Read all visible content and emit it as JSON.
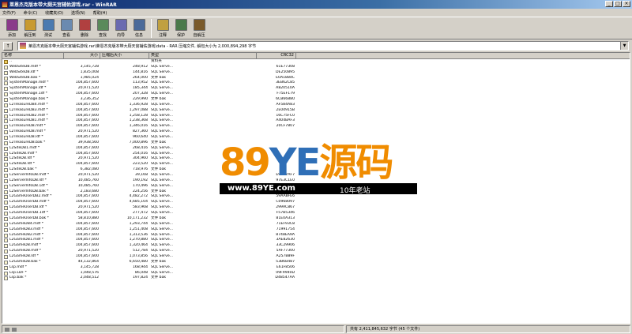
{
  "window": {
    "title": "莱恩杰克版本带大厕天宫辅佑游戏.rar - WinRAR",
    "min": "_",
    "max": "□",
    "close": "×"
  },
  "menu": [
    "文件(F)",
    "命令(C)",
    "收藏夹(O)",
    "选项(N)",
    "帮助(H)"
  ],
  "toolbar": [
    {
      "label": "添加",
      "icon": "add-icon",
      "color": "#8a3a8a"
    },
    {
      "label": "解压到",
      "icon": "extract-to-icon",
      "color": "#c89a30"
    },
    {
      "label": "测试",
      "icon": "test-icon",
      "color": "#4a7ab0"
    },
    {
      "label": "查看",
      "icon": "view-icon",
      "color": "#6a8ab0"
    },
    {
      "label": "删除",
      "icon": "delete-icon",
      "color": "#b04040"
    },
    {
      "label": "查找",
      "icon": "find-icon",
      "color": "#5a8a5a"
    },
    {
      "label": "向导",
      "icon": "wizard-icon",
      "color": "#6a6ab0"
    },
    {
      "label": "信息",
      "icon": "info-icon",
      "color": "#4a6a9a"
    },
    {
      "label": "注释",
      "icon": "comment-icon",
      "color": "#c0a040"
    },
    {
      "label": "保护",
      "icon": "protect-icon",
      "color": "#4a7a4a"
    },
    {
      "label": "自解压",
      "icon": "sfx-icon",
      "color": "#7a5a2a"
    }
  ],
  "path": {
    "text": "莱恩杰克版本带大厕天宫辅佑游戏.rar\\莱恩杰克版本带大厕天宫辅佑游戏\\data - RAR 压缩文件, 解包大小为 2,000,894,298 字节"
  },
  "columns": {
    "name": "名称",
    "size": "大小",
    "packed": "压缩后大小",
    "type": "类型",
    "crc": "CRC32"
  },
  "rows": [
    {
      "name": "..",
      "size": "",
      "packed": "",
      "type": "资料夹",
      "crc": "",
      "up": true
    },
    {
      "name": "WebSiteDB.mdf *",
      "size": "3,145,728",
      "packed": "248,912",
      "type": "SQL Serve...",
      "crc": "61E77308"
    },
    {
      "name": "WebSiteDB.ldf *",
      "size": "1,835,008",
      "packed": "144,816",
      "type": "SQL Serve...",
      "crc": "DE250895"
    },
    {
      "name": "WebSiteDB.bak *",
      "size": "1,985,024",
      "packed": "264,000",
      "type": "文件 bak",
      "crc": "E0A1884C"
    },
    {
      "name": "SystemManage.mdf *",
      "size": "104,857,600",
      "packed": "113,952",
      "type": "SQL Serve...",
      "crc": "3EB62C85"
    },
    {
      "name": "SystemManage.ldf *",
      "size": "20,971,520",
      "packed": "185,344",
      "type": "SQL Serve...",
      "crc": "A820510A"
    },
    {
      "name": "SystemManage.1df *",
      "size": "104,857,600",
      "packed": "207,328",
      "type": "SQL Serve...",
      "crc": "F75EF179"
    },
    {
      "name": "SystemManage.bak *",
      "size": "3,236,352",
      "packed": "229,990",
      "type": "文件 bak",
      "crc": "6CB66880"
    },
    {
      "name": "L2TreasureDB4.mdf *",
      "size": "104,857,600",
      "packed": "1,336,928",
      "type": "SQL Serve...",
      "crc": "AF584A83"
    },
    {
      "name": "L2TreasureDB3.mdf *",
      "size": "104,857,600",
      "packed": "1,297,088",
      "type": "SQL Serve...",
      "crc": "2E04915B"
    },
    {
      "name": "L2TreasureDB2.mdf *",
      "size": "104,857,600",
      "packed": "1,258,128",
      "type": "SQL Serve...",
      "crc": "16C75FC0"
    },
    {
      "name": "L2TreasureDB1.mdf *",
      "size": "104,857,600",
      "packed": "1,238,368",
      "type": "SQL Serve...",
      "crc": "A404BAF3"
    },
    {
      "name": "L2TreasureDB.mdf *",
      "size": "104,857,600",
      "packed": "1,346,016",
      "type": "SQL Serve...",
      "crc": "20CF7807"
    },
    {
      "name": "L2TreasureDB.mdf *",
      "size": "20,971,520",
      "packed": "827,360",
      "type": "SQL Serve...",
      "crc": ""
    },
    {
      "name": "L2TreasureDB.ldf *",
      "size": "104,857,600",
      "packed": "960,640",
      "type": "SQL Serve...",
      "crc": ""
    },
    {
      "name": "L2TreasureDB.bak *",
      "size": "39,938,560",
      "packed": "7,000,896",
      "type": "文件 bak",
      "crc": ""
    },
    {
      "name": "L2SiteDB1.mdf *",
      "size": "104,857,600",
      "packed": "268,416",
      "type": "SQL Serve...",
      "crc": ""
    },
    {
      "name": "L2SiteDB.mdf *",
      "size": "104,857,600",
      "packed": "254,016",
      "type": "SQL Serve...",
      "crc": ""
    },
    {
      "name": "L2SiteDB.ldf *",
      "size": "20,971,520",
      "packed": "304,960",
      "type": "SQL Serve...",
      "crc": ""
    },
    {
      "name": "L2SiteDB.ldf *",
      "size": "104,857,600",
      "packed": "223,520",
      "type": "SQL Serve...",
      "crc": ""
    },
    {
      "name": "L2SiteDB.bak *",
      "size": "6,382,080",
      "packed": "718,976",
      "type": "文件 bak",
      "crc": ""
    },
    {
      "name": "L2ServerInfoDB.mdf *",
      "size": "20,971,520",
      "packed": "39,168",
      "type": "SQL Serve...",
      "crc": "E93C7AF7"
    },
    {
      "name": "L2ServerInfoDB.ldf *",
      "size": "10,485,760",
      "packed": "190,192",
      "type": "SQL Serve...",
      "crc": "97E3C1E0"
    },
    {
      "name": "L2ServerInfoDB.1df *",
      "size": "10,485,760",
      "packed": "170,496",
      "type": "SQL Serve...",
      "crc": "7A13BC8F"
    },
    {
      "name": "L2ServerInfoDB.bak *",
      "size": "2,183,680",
      "packed": "224,256",
      "type": "文件 bak",
      "crc": "0C35994C"
    },
    {
      "name": "L2GameUserDB2.mdf *",
      "size": "104,857,600",
      "packed": "4,482,272",
      "type": "SQL Serve...",
      "crc": "59AA8FE6"
    },
    {
      "name": "L2GameUserDB.mdf *",
      "size": "104,857,600",
      "packed": "4,685,104",
      "type": "SQL Serve...",
      "crc": "C0968097"
    },
    {
      "name": "L2GameUserDB.ldf *",
      "size": "20,971,520",
      "packed": "583,968",
      "type": "SQL Serve...",
      "crc": "299AC867"
    },
    {
      "name": "L2GameUserDB.1df *",
      "size": "104,857,600",
      "packed": "277,472",
      "type": "SQL Serve...",
      "crc": "F57B5346"
    },
    {
      "name": "L2GameUserDB.bak *",
      "size": "58,810,880",
      "packed": "10,171,232",
      "type": "文件 bak",
      "crc": "81E0A313"
    },
    {
      "name": "L2GameDB4.mdf *",
      "size": "104,857,600",
      "packed": "1,293,744",
      "type": "SQL Serve...",
      "crc": "71EF93C8"
    },
    {
      "name": "L2GameDB3.mdf *",
      "size": "104,857,600",
      "packed": "1,251,408",
      "type": "SQL Serve...",
      "crc": "71991754"
    },
    {
      "name": "L2GameDB2.mdf *",
      "size": "104,857,600",
      "packed": "1,313,536",
      "type": "SQL Serve...",
      "crc": "8748EA9A"
    },
    {
      "name": "L2GameDB1.mdf *",
      "size": "104,857,600",
      "packed": "1,270,880",
      "type": "SQL Serve...",
      "crc": "3AE82630"
    },
    {
      "name": "L2GameDB.mdf *",
      "size": "104,857,600",
      "packed": "1,320,464",
      "type": "SQL Serve...",
      "crc": "33C29906"
    },
    {
      "name": "L2GameDB.mdf *",
      "size": "20,971,520",
      "packed": "512,784",
      "type": "SQL Serve...",
      "crc": "5AF77300"
    },
    {
      "name": "L2GameDB.ldf *",
      "size": "104,857,600",
      "packed": "1,073,856",
      "type": "SQL Serve...",
      "crc": "A257B89F"
    },
    {
      "name": "L2GameDB.bak *",
      "size": "44,132,864",
      "packed": "6,650,480",
      "type": "文件 bak",
      "crc": "53B6B487"
    },
    {
      "name": "Lsp.mdf *",
      "size": "3,145,728",
      "packed": "168,944",
      "type": "SQL Serve...",
      "crc": "E61F8506"
    },
    {
      "name": "Lsp.LDF *",
      "size": "1,048,576",
      "packed": "86,048",
      "type": "SQL Serve...",
      "crc": "09F9940D"
    },
    {
      "name": "Lsp.bak *",
      "size": "2,048,512",
      "packed": "197,824",
      "type": "文件 bak",
      "crc": "D48547AA"
    }
  ],
  "watermark": {
    "n89": "89",
    "ye": "YE",
    "cn": "源码",
    "url": "www.89YE.com",
    "slogan": "10年老站"
  },
  "status": {
    "right": "共有 2,411,845,632 字节 (45 个文件)"
  }
}
